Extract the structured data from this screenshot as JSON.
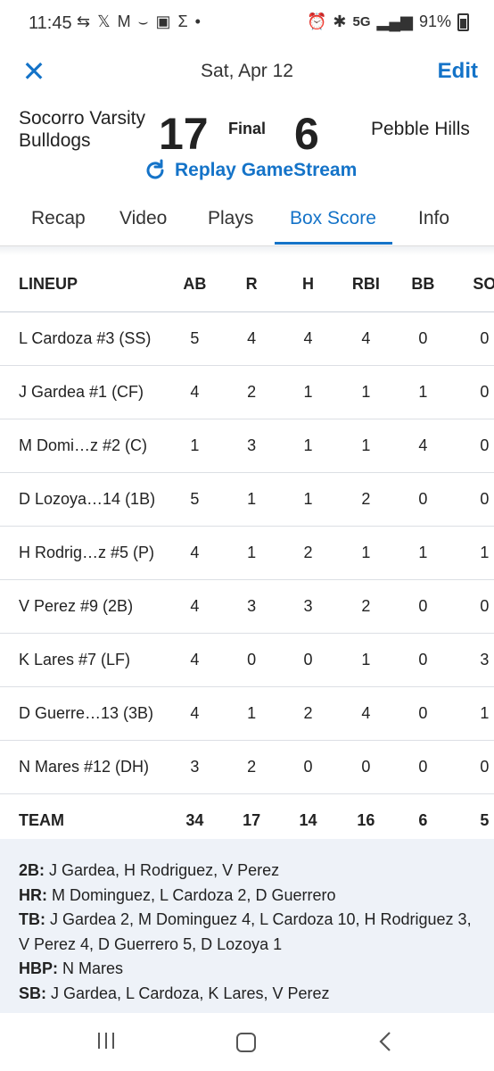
{
  "status": {
    "time": "11:45",
    "left_icons": [
      "sync-icon",
      "x-icon",
      "gmail-icon",
      "amazon-icon",
      "gallery-icon",
      "sigma-icon",
      "dot-icon"
    ],
    "right_icons": [
      "alarm-icon",
      "bluetooth-icon",
      "5g-icon",
      "signal-icon"
    ],
    "network": "5G",
    "battery": "91%"
  },
  "header": {
    "close_label": "✕",
    "date": "Sat, Apr 12",
    "edit_label": "Edit"
  },
  "game": {
    "home_team_line1": "Socorro Varsity",
    "home_team_line2": "Bulldogs",
    "home_score": "17",
    "status": "Final",
    "away_score": "6",
    "away_team": "Pebble Hills",
    "replay_label": "Replay GameStream"
  },
  "tabs": [
    {
      "label": "Recap"
    },
    {
      "label": "Video"
    },
    {
      "label": "Plays"
    },
    {
      "label": "Box Score"
    },
    {
      "label": "Info"
    }
  ],
  "box": {
    "headers": [
      "LINEUP",
      "AB",
      "R",
      "H",
      "RBI",
      "BB",
      "SO"
    ],
    "rows": [
      [
        "L Cardoza #3 (SS)",
        "5",
        "4",
        "4",
        "4",
        "0",
        "0"
      ],
      [
        "J Gardea #1 (CF)",
        "4",
        "2",
        "1",
        "1",
        "1",
        "0"
      ],
      [
        "M Domi…z #2 (C)",
        "1",
        "3",
        "1",
        "1",
        "4",
        "0"
      ],
      [
        "D Lozoya…14 (1B)",
        "5",
        "1",
        "1",
        "2",
        "0",
        "0"
      ],
      [
        "H Rodrig…z #5 (P)",
        "4",
        "1",
        "2",
        "1",
        "1",
        "1"
      ],
      [
        "V Perez #9 (2B)",
        "4",
        "3",
        "3",
        "2",
        "0",
        "0"
      ],
      [
        "K Lares #7 (LF)",
        "4",
        "0",
        "0",
        "1",
        "0",
        "3"
      ],
      [
        "D Guerre…13 (3B)",
        "4",
        "1",
        "2",
        "4",
        "0",
        "1"
      ],
      [
        "N Mares #12 (DH)",
        "3",
        "2",
        "0",
        "0",
        "0",
        "0"
      ]
    ],
    "team_row": [
      "TEAM",
      "34",
      "17",
      "14",
      "16",
      "6",
      "5"
    ]
  },
  "notes": [
    {
      "label": "2B:",
      "text": " J Gardea, H Rodriguez, V Perez"
    },
    {
      "label": "HR:",
      "text": " M Dominguez, L Cardoza 2, D Guerrero"
    },
    {
      "label": "TB:",
      "text": " J Gardea 2, M Dominguez 4, L Cardoza 10, H Rodriguez 3, V Perez 4, D Guerrero 5, D Lozoya 1"
    },
    {
      "label": "HBP:",
      "text": " N Mares"
    },
    {
      "label": "SB:",
      "text": " J Gardea, L Cardoza, K Lares, V Perez"
    }
  ],
  "colors": {
    "accent": "#1473c8",
    "notes_bg": "#eef2f8"
  }
}
